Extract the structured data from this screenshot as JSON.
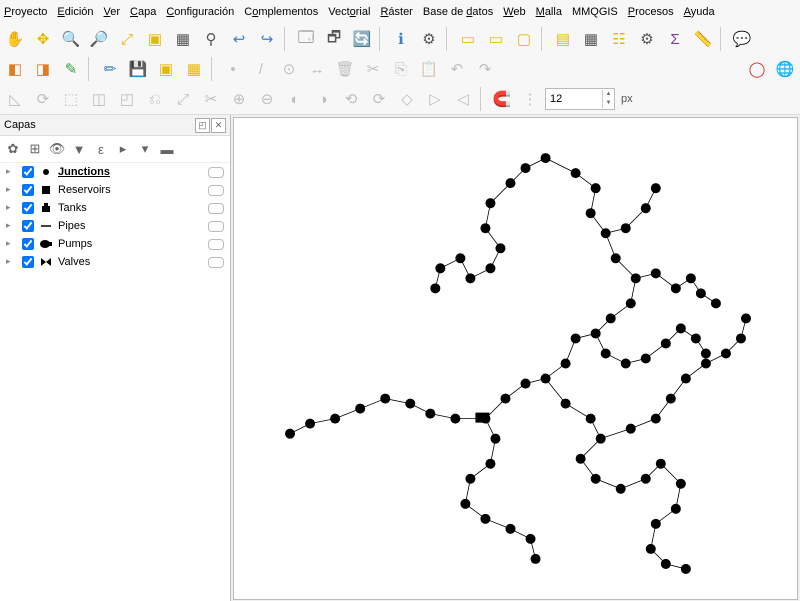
{
  "menu": {
    "items": [
      {
        "label": "Proyecto",
        "u": 0
      },
      {
        "label": "Edición",
        "u": 0
      },
      {
        "label": "Ver",
        "u": 0
      },
      {
        "label": "Capa",
        "u": 0
      },
      {
        "label": "Configuración",
        "u": 0
      },
      {
        "label": "Complementos",
        "u": 1
      },
      {
        "label": "Vectorial",
        "u": 4
      },
      {
        "label": "Ráster",
        "u": 0
      },
      {
        "label": "Base de datos",
        "u": 8
      },
      {
        "label": "Web",
        "u": 0
      },
      {
        "label": "Malla",
        "u": 0
      },
      {
        "label": "MMQGIS",
        "u": -1
      },
      {
        "label": "Procesos",
        "u": 0
      },
      {
        "label": "Ayuda",
        "u": 0
      }
    ]
  },
  "toolbar": {
    "spin_value": "12",
    "spin_unit": "px"
  },
  "layers_panel": {
    "title": "Capas",
    "items": [
      {
        "label": "Junctions",
        "checked": true,
        "selected": true,
        "symbol": "point"
      },
      {
        "label": "Reservoirs",
        "checked": true,
        "selected": false,
        "symbol": "square"
      },
      {
        "label": "Tanks",
        "checked": true,
        "selected": false,
        "symbol": "tank"
      },
      {
        "label": "Pipes",
        "checked": true,
        "selected": false,
        "symbol": "line"
      },
      {
        "label": "Pumps",
        "checked": true,
        "selected": false,
        "symbol": "pump"
      },
      {
        "label": "Valves",
        "checked": true,
        "selected": false,
        "symbol": "valve"
      }
    ]
  }
}
